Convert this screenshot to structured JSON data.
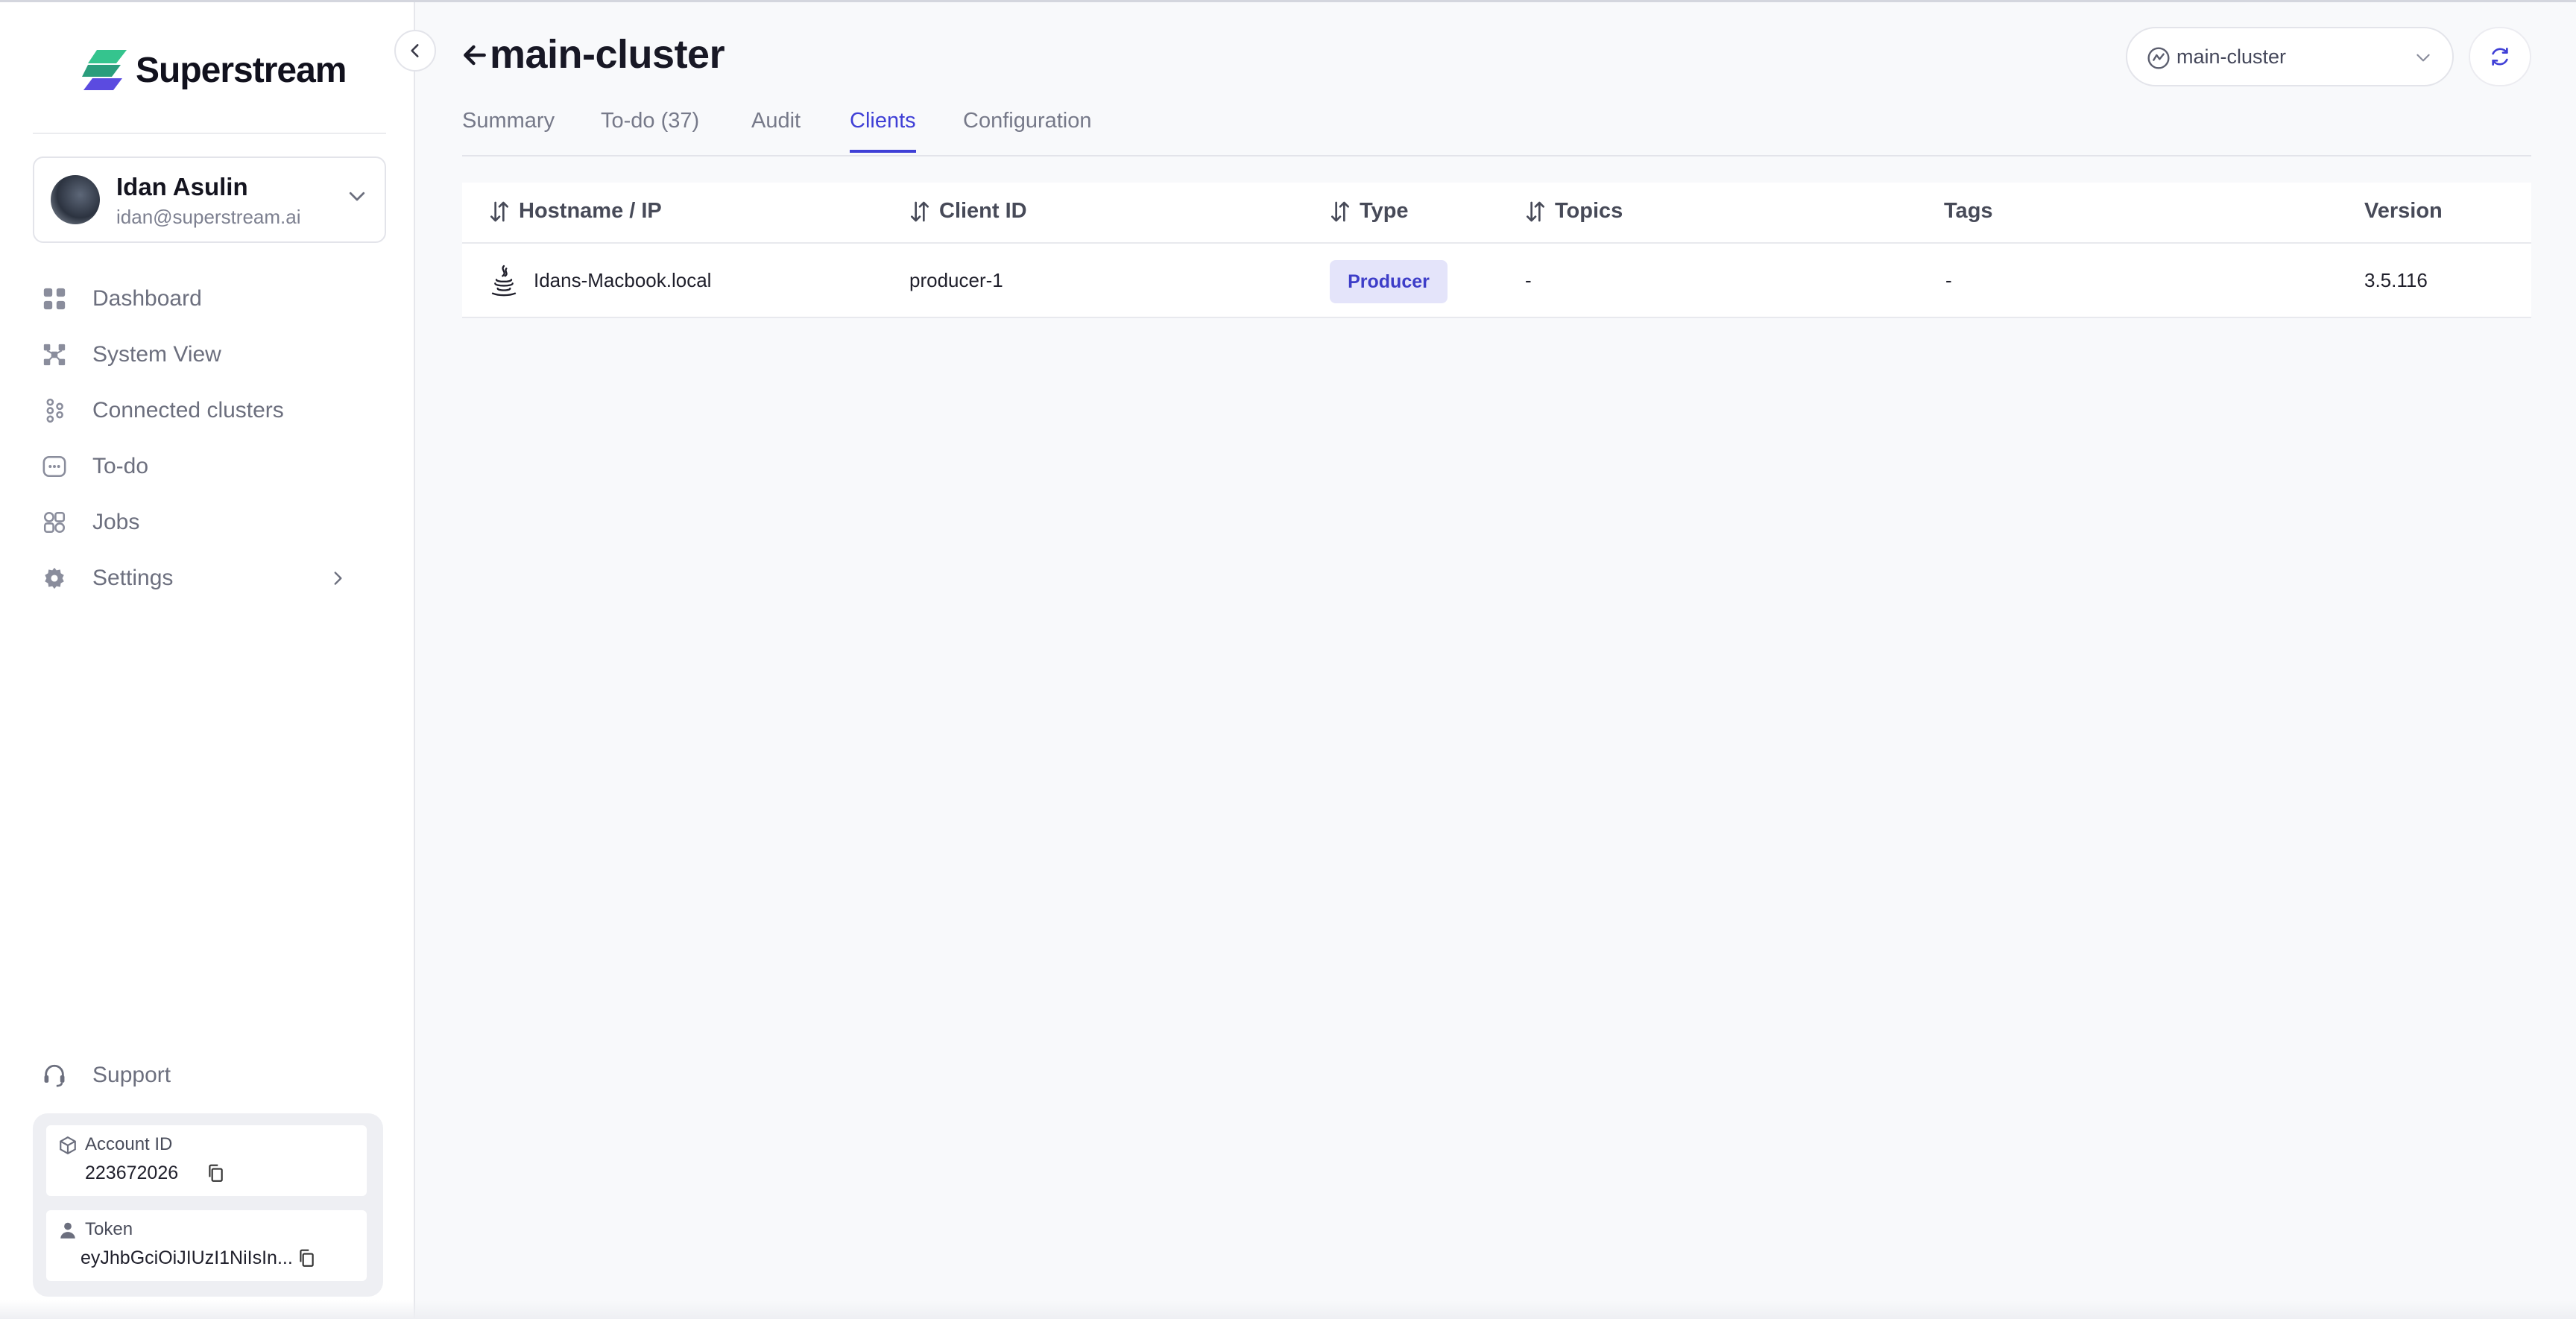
{
  "brand": {
    "name": "Superstream"
  },
  "user": {
    "name": "Idan Asulin",
    "email": "idan@superstream.ai"
  },
  "nav": {
    "items": [
      {
        "label": "Dashboard"
      },
      {
        "label": "System View"
      },
      {
        "label": "Connected clusters"
      },
      {
        "label": "To-do"
      },
      {
        "label": "Jobs"
      },
      {
        "label": "Settings"
      }
    ],
    "support": "Support"
  },
  "account": {
    "title": "Account ID",
    "id": "223672026",
    "token_title": "Token",
    "token": "eyJhbGciOiJIUzI1NiIsIn..."
  },
  "page": {
    "title": "main-cluster"
  },
  "cluster_select": {
    "value": "main-cluster"
  },
  "tabs": [
    {
      "label": "Summary"
    },
    {
      "label": "To-do (37)"
    },
    {
      "label": "Audit"
    },
    {
      "label": "Clients"
    },
    {
      "label": "Configuration"
    }
  ],
  "table": {
    "headers": [
      "Hostname / IP",
      "Client ID",
      "Type",
      "Topics",
      "Tags",
      "Version"
    ],
    "rows": [
      {
        "hostname": "Idans-Macbook.local",
        "client_id": "producer-1",
        "type": "Producer",
        "topics": "-",
        "tags": "-",
        "version": "3.5.116"
      }
    ]
  },
  "colors": {
    "accent": "#3f3fd6",
    "badge_bg": "#e4e4fa",
    "logo_primary": "#2fbf8f",
    "logo_secondary": "#5b4be0"
  }
}
